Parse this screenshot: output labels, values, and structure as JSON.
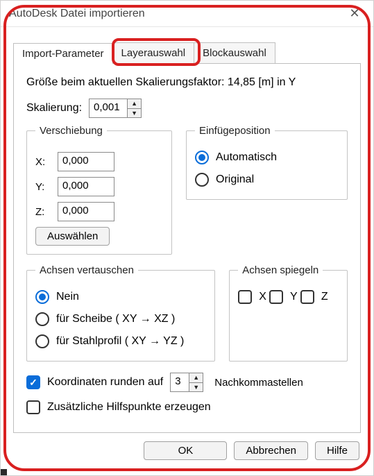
{
  "window": {
    "title": "AutoDesk Datei importieren"
  },
  "tabs": {
    "t0": "Import-Parameter",
    "t1": "Layerauswahl",
    "t2": "Blockauswahl"
  },
  "info": "Größe beim aktuellen Skalierungsfaktor: 14,85 [m] in Y",
  "scale": {
    "label": "Skalierung:",
    "value": "0,001"
  },
  "shift": {
    "legend": "Verschiebung",
    "x": {
      "label": "X:",
      "value": "0,000"
    },
    "y": {
      "label": "Y:",
      "value": "0,000"
    },
    "z": {
      "label": "Z:",
      "value": "0,000"
    },
    "choose": "Auswählen"
  },
  "insert": {
    "legend": "Einfügeposition",
    "auto": "Automatisch",
    "orig": "Original"
  },
  "swap": {
    "legend": "Achsen vertauschen",
    "none": "Nein",
    "xy_xz": "für Scheibe ( XY → XZ )",
    "xy_yz": "für Stahlprofil ( XY → YZ )"
  },
  "mirror": {
    "legend": "Achsen spiegeln",
    "x": "X",
    "y": "Y",
    "z": "Z"
  },
  "round": {
    "label": "Koordinaten runden auf",
    "value": "3",
    "tail": "Nachkommastellen"
  },
  "extra": {
    "label": "Zusätzliche Hilfspunkte erzeugen"
  },
  "buttons": {
    "ok": "OK",
    "cancel": "Abbrechen",
    "help": "Hilfe"
  }
}
